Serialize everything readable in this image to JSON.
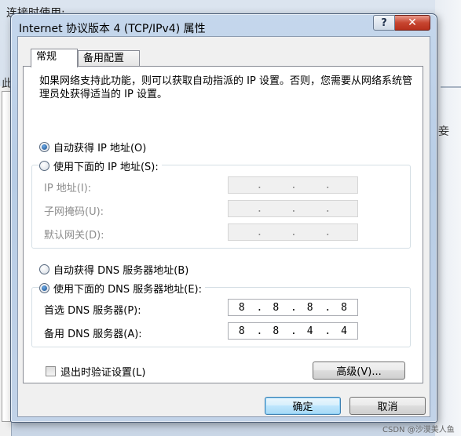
{
  "background": {
    "title": "连接时使用:",
    "left_char": "此",
    "right_char": "妾"
  },
  "dialog": {
    "title": "Internet 协议版本 4 (TCP/IPv4) 属性",
    "help_glyph": "?",
    "close_glyph": "✕"
  },
  "tabs": [
    {
      "label": "常规"
    },
    {
      "label": "备用配置"
    }
  ],
  "description": "如果网络支持此功能，则可以获取自动指派的 IP 设置。否则，您需要从网络系统管理员处获得适当的 IP 设置。",
  "ip_section": {
    "auto_label": "自动获得 IP 地址(O)",
    "manual_label": "使用下面的 IP 地址(S):",
    "auto_selected": true,
    "fields": [
      {
        "label": "IP 地址(I):",
        "segments": [
          "",
          "",
          "",
          ""
        ]
      },
      {
        "label": "子网掩码(U):",
        "segments": [
          "",
          "",
          "",
          ""
        ]
      },
      {
        "label": "默认网关(D):",
        "segments": [
          "",
          "",
          "",
          ""
        ]
      }
    ]
  },
  "dns_section": {
    "auto_label": "自动获得 DNS 服务器地址(B)",
    "manual_label": "使用下面的 DNS 服务器地址(E):",
    "manual_selected": true,
    "fields": [
      {
        "label": "首选 DNS 服务器(P):",
        "segments": [
          "8",
          "8",
          "8",
          "8"
        ]
      },
      {
        "label": "备用 DNS 服务器(A):",
        "segments": [
          "8",
          "8",
          "4",
          "4"
        ]
      }
    ]
  },
  "validate_label": "退出时验证设置(L)",
  "advanced_label": "高级(V)...",
  "ok_label": "确定",
  "cancel_label": "取消",
  "watermark": "CSDN @沙漠美人鱼",
  "colors": {
    "accent_radio": "#1d4f8a",
    "close_button": "#c74530",
    "default_button_border": "#3c7fb1"
  }
}
